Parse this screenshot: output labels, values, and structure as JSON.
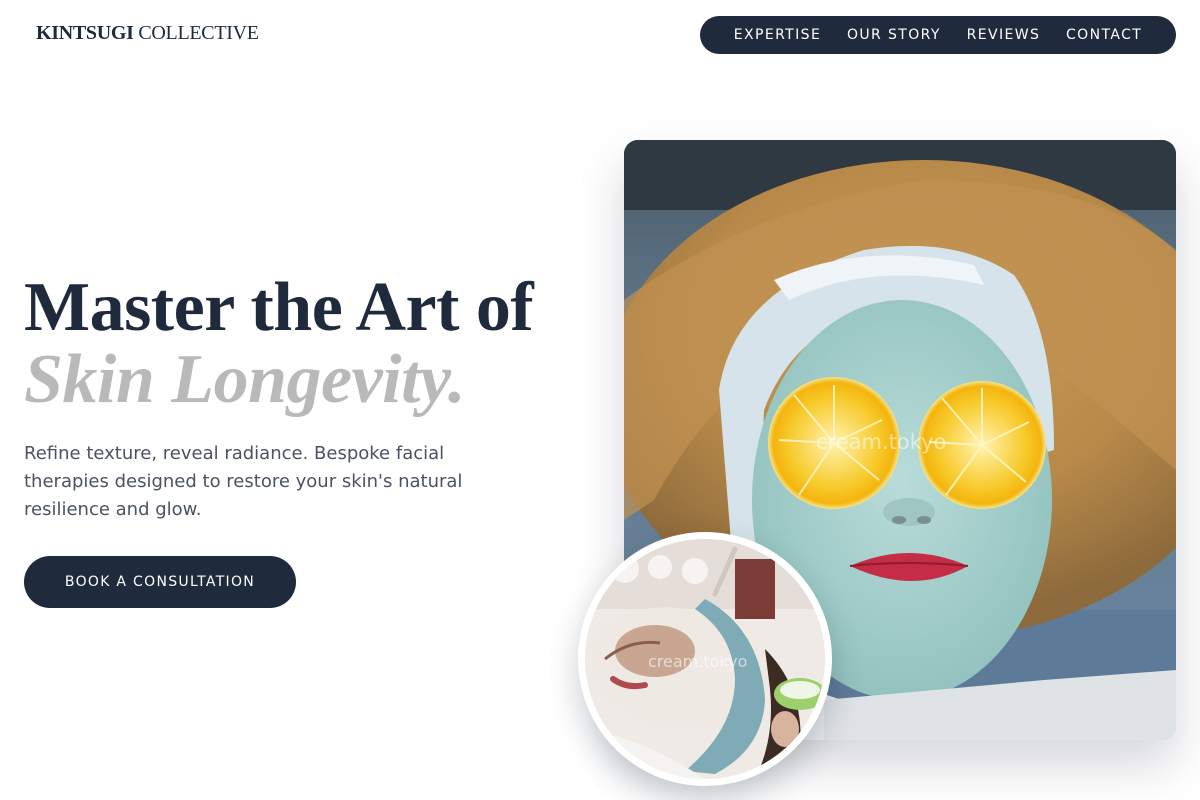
{
  "brand": {
    "name_bold": "KINTSUGI",
    "name_light": "COLLECTIVE"
  },
  "nav": {
    "items": [
      {
        "label": "EXPERTISE"
      },
      {
        "label": "OUR STORY"
      },
      {
        "label": "REVIEWS"
      },
      {
        "label": "CONTACT"
      }
    ]
  },
  "hero": {
    "title_line1": "Master the Art of",
    "title_line2": "Skin Longevity.",
    "description": "Refine texture, reveal radiance. Bespoke facial therapies designed to restore your skin's natural resilience and glow.",
    "cta_label": "BOOK A CONSULTATION"
  },
  "images": {
    "main_alt": "Woman with blue clay face mask and lemon slices over her eyes",
    "inset_alt": "Client receiving a white facial mask treatment",
    "watermark_main": "cream.tokyo",
    "watermark_inset": "cream.tokyo"
  },
  "colors": {
    "navy": "#1f2a3d",
    "muted_title": "#b9b9bb",
    "body_text": "#4b5263",
    "background": "#ffffff"
  }
}
